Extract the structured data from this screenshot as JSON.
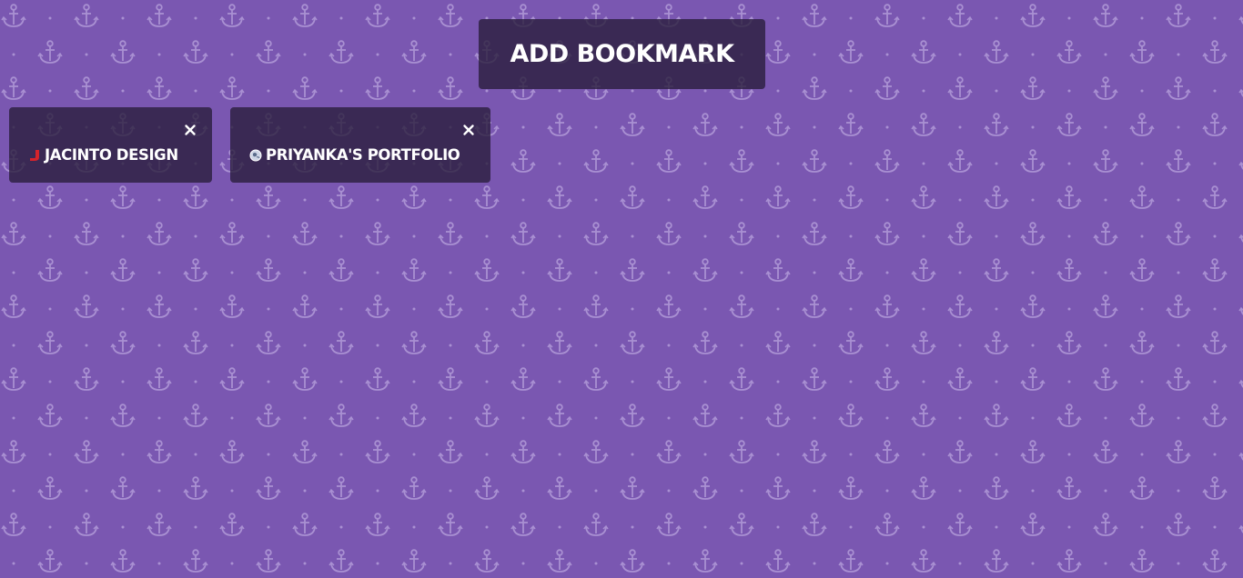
{
  "add_button": {
    "label": "ADD BOOKMARK"
  },
  "bookmarks": [
    {
      "title": "JACINTO DESIGN",
      "favicon": "jacinto-j-favicon",
      "close": "close-icon"
    },
    {
      "title": "PRIYANKA'S PORTFOLIO",
      "favicon": "globe-favicon",
      "close": "close-icon"
    }
  ],
  "colors": {
    "background": "#7a57b1",
    "pattern": "#a990d2",
    "panel": "#2a1d3e",
    "text": "#ffffff",
    "favicon_red": "#d4232b"
  }
}
